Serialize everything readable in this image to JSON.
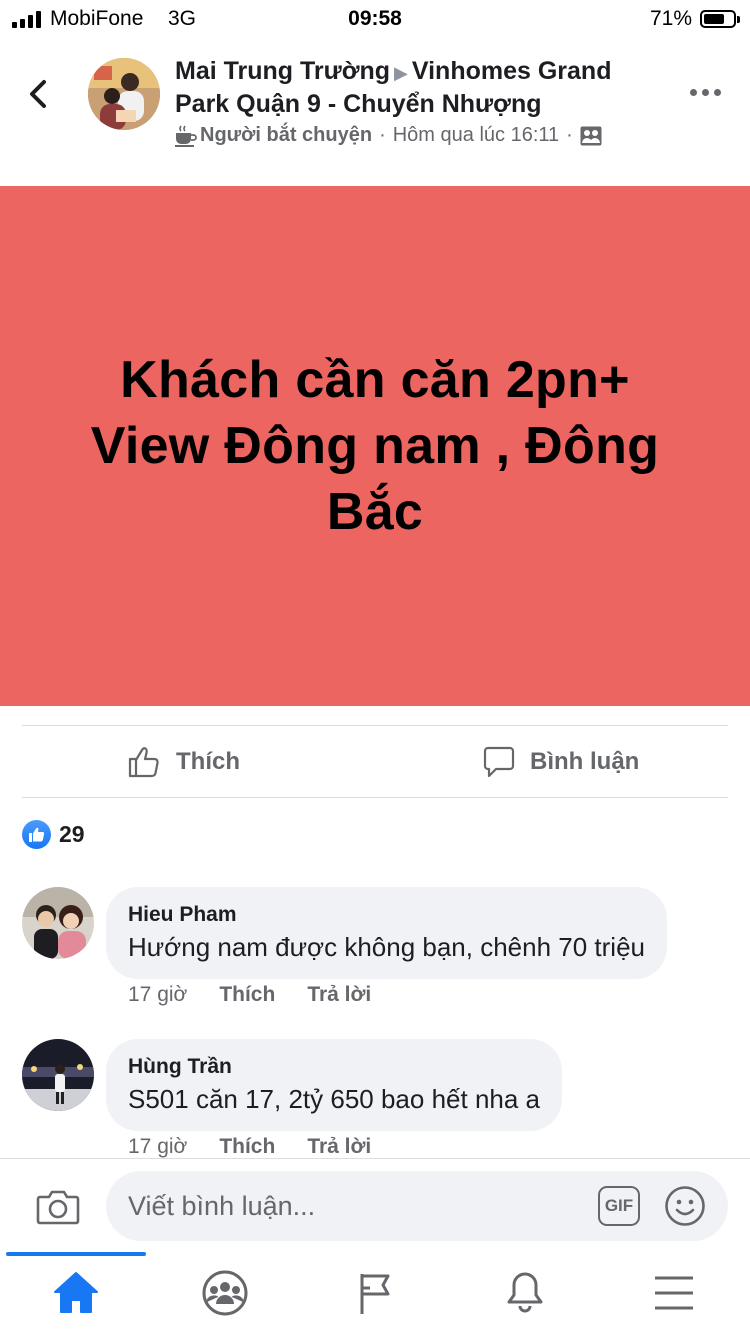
{
  "status_bar": {
    "carrier": "MobiFone",
    "network": "3G",
    "time": "09:58",
    "battery": "71%",
    "battery_level": 0.71
  },
  "header": {
    "author": "Mai Trung Trường",
    "group": "Vinhomes Grand Park Quận 9 - Chuyển Nhượng",
    "badge": "Người bắt chuyện",
    "time": "Hôm qua lúc 16:11",
    "icons": [
      "back-chevron-icon",
      "coffee-cup-icon",
      "group-members-icon",
      "more-dots-icon"
    ]
  },
  "post": {
    "text": "Khách cần căn 2pn+ View Đông nam , Đông Bắc",
    "background_color": "#ec6560"
  },
  "actions": {
    "like_label": "Thích",
    "comment_label": "Bình luận"
  },
  "reactions": {
    "count": "29"
  },
  "comments": [
    {
      "name": "Hieu Pham",
      "text": "Hướng nam được không bạn, chênh 70 triệu",
      "time": "17 giờ",
      "like_label": "Thích",
      "reply_label": "Trả lời"
    },
    {
      "name": "Hùng Trần",
      "text": "S501 căn 17, 2tỷ 650 bao hết nha a",
      "time": "17 giờ",
      "like_label": "Thích",
      "reply_label": "Trả lời"
    }
  ],
  "composer": {
    "placeholder": "Viết bình luận...",
    "gif_label": "GIF"
  },
  "tabbar": {
    "items": [
      "home-icon",
      "groups-icon",
      "pages-flag-icon",
      "notifications-bell-icon",
      "menu-icon"
    ],
    "active": "home-icon"
  },
  "colors": {
    "accent": "#1877f2",
    "secondary_text": "#65676b",
    "bubble": "#f0f2f5"
  }
}
